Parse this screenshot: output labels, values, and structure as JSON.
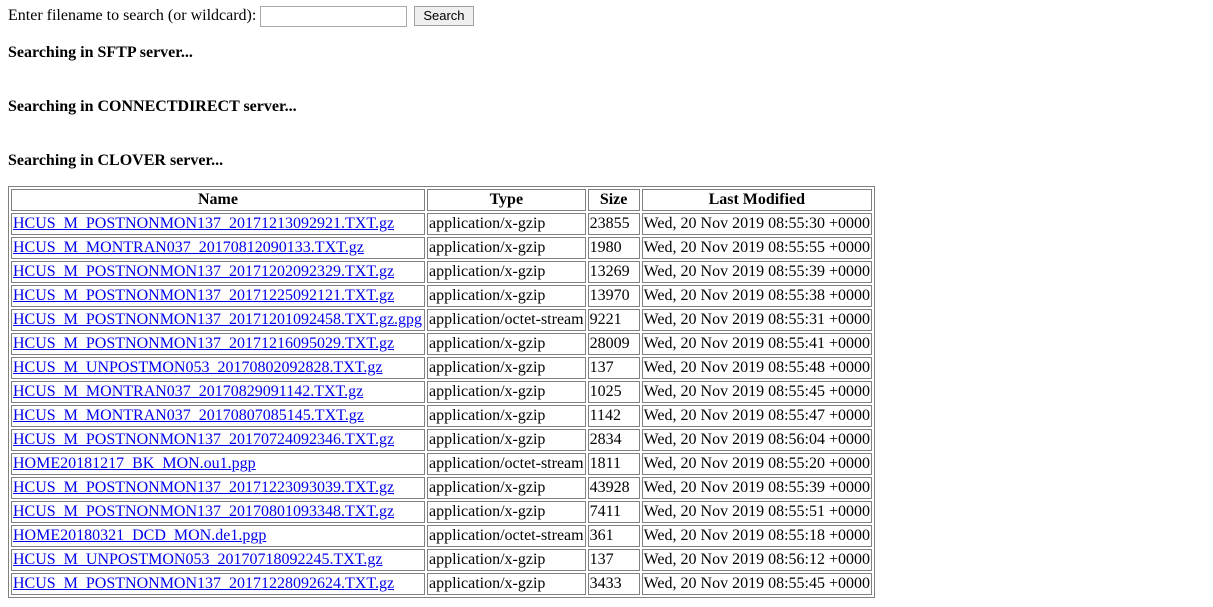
{
  "search": {
    "label": "Enter filename to search (or wildcard):",
    "value": "",
    "placeholder": "",
    "button_label": "Search"
  },
  "status_messages": [
    "Searching in SFTP server...",
    "Searching in CONNECTDIRECT server...",
    "Searching in CLOVER server..."
  ],
  "table": {
    "headers": [
      "Name",
      "Type",
      "Size",
      "Last Modified"
    ],
    "rows": [
      {
        "name": "HCUS_M_POSTNONMON137_20171213092921.TXT.gz",
        "type": "application/x-gzip",
        "size": "23855",
        "modified": "Wed, 20 Nov 2019 08:55:30 +0000"
      },
      {
        "name": "HCUS_M_MONTRAN037_20170812090133.TXT.gz",
        "type": "application/x-gzip",
        "size": "1980",
        "modified": "Wed, 20 Nov 2019 08:55:55 +0000"
      },
      {
        "name": "HCUS_M_POSTNONMON137_20171202092329.TXT.gz",
        "type": "application/x-gzip",
        "size": "13269",
        "modified": "Wed, 20 Nov 2019 08:55:39 +0000"
      },
      {
        "name": "HCUS_M_POSTNONMON137_20171225092121.TXT.gz",
        "type": "application/x-gzip",
        "size": "13970",
        "modified": "Wed, 20 Nov 2019 08:55:38 +0000"
      },
      {
        "name": "HCUS_M_POSTNONMON137_20171201092458.TXT.gz.gpg",
        "type": "application/octet-stream",
        "size": "9221",
        "modified": "Wed, 20 Nov 2019 08:55:31 +0000"
      },
      {
        "name": "HCUS_M_POSTNONMON137_20171216095029.TXT.gz",
        "type": "application/x-gzip",
        "size": "28009",
        "modified": "Wed, 20 Nov 2019 08:55:41 +0000"
      },
      {
        "name": "HCUS_M_UNPOSTMON053_20170802092828.TXT.gz",
        "type": "application/x-gzip",
        "size": "137",
        "modified": "Wed, 20 Nov 2019 08:55:48 +0000"
      },
      {
        "name": "HCUS_M_MONTRAN037_20170829091142.TXT.gz",
        "type": "application/x-gzip",
        "size": "1025",
        "modified": "Wed, 20 Nov 2019 08:55:45 +0000"
      },
      {
        "name": "HCUS_M_MONTRAN037_20170807085145.TXT.gz",
        "type": "application/x-gzip",
        "size": "1142",
        "modified": "Wed, 20 Nov 2019 08:55:47 +0000"
      },
      {
        "name": "HCUS_M_POSTNONMON137_20170724092346.TXT.gz",
        "type": "application/x-gzip",
        "size": "2834",
        "modified": "Wed, 20 Nov 2019 08:56:04 +0000"
      },
      {
        "name": "HOME20181217_BK_MON.ou1.pgp",
        "type": "application/octet-stream",
        "size": "1811",
        "modified": "Wed, 20 Nov 2019 08:55:20 +0000"
      },
      {
        "name": "HCUS_M_POSTNONMON137_20171223093039.TXT.gz",
        "type": "application/x-gzip",
        "size": "43928",
        "modified": "Wed, 20 Nov 2019 08:55:39 +0000"
      },
      {
        "name": "HCUS_M_POSTNONMON137_20170801093348.TXT.gz",
        "type": "application/x-gzip",
        "size": "7411",
        "modified": "Wed, 20 Nov 2019 08:55:51 +0000"
      },
      {
        "name": "HOME20180321_DCD_MON.de1.pgp",
        "type": "application/octet-stream",
        "size": "361",
        "modified": "Wed, 20 Nov 2019 08:55:18 +0000"
      },
      {
        "name": "HCUS_M_UNPOSTMON053_20170718092245.TXT.gz",
        "type": "application/x-gzip",
        "size": "137",
        "modified": "Wed, 20 Nov 2019 08:56:12 +0000"
      },
      {
        "name": "HCUS_M_POSTNONMON137_20171228092624.TXT.gz",
        "type": "application/x-gzip",
        "size": "3433",
        "modified": "Wed, 20 Nov 2019 08:55:45 +0000"
      }
    ]
  },
  "colors": {
    "link": "#0000ee",
    "border": "#808080"
  }
}
